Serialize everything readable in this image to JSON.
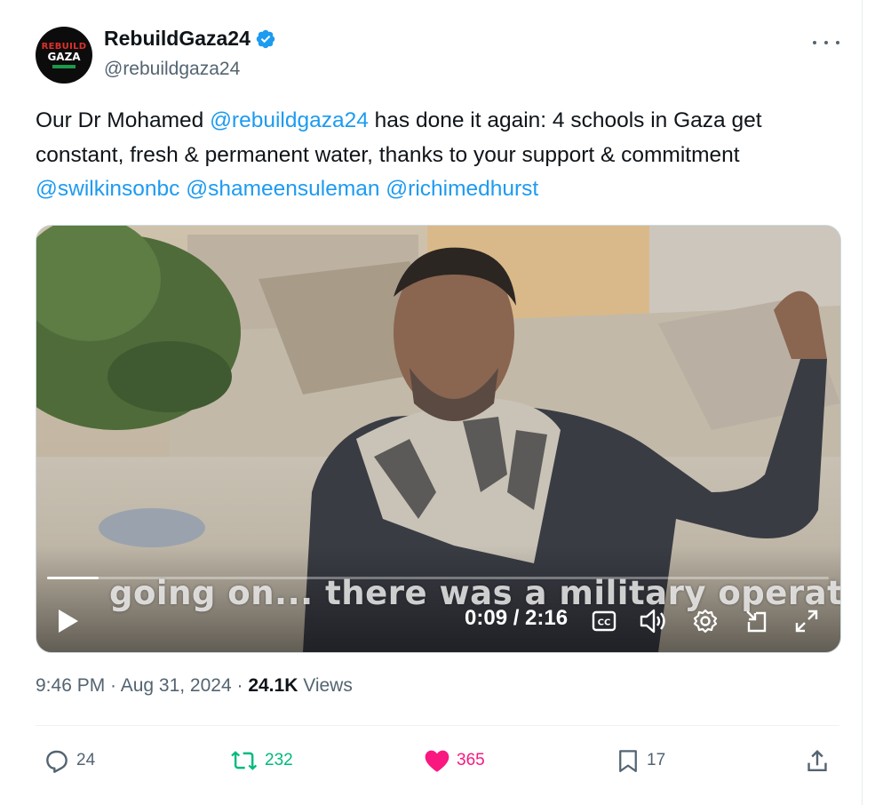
{
  "tweet": {
    "author": {
      "name": "RebuildGaza24",
      "handle": "@rebuildgaza24",
      "avatar_line1": "REBUILD",
      "avatar_line2": "GAZA",
      "verified_icon": "verified-badge-icon"
    },
    "text_segments": [
      {
        "text": "Our Dr Mohamed ",
        "type": "plain"
      },
      {
        "text": "@rebuildgaza24",
        "type": "mention"
      },
      {
        "text": " has done it again: 4 schools in Gaza get constant, fresh & permanent water, thanks to your support & commitment ",
        "type": "plain"
      },
      {
        "text": "@swilkinsonbc",
        "type": "mention"
      },
      {
        "text": " ",
        "type": "plain"
      },
      {
        "text": "@shameensuleman",
        "type": "mention"
      },
      {
        "text": " ",
        "type": "plain"
      },
      {
        "text": "@richimedhurst",
        "type": "mention"
      }
    ],
    "video": {
      "subtitle": "going on... there was a military operation",
      "time": "0:09 / 2:16",
      "progress": 0.066,
      "controls": [
        "play-icon",
        "captions-icon",
        "volume-icon",
        "settings-icon",
        "pip-icon",
        "fullscreen-icon"
      ]
    },
    "timestamp": "9:46 PM · Aug 31, 2024 · ",
    "views_count": "24.1K",
    "views_label": " Views",
    "actions": {
      "replies": "24",
      "reposts": "232",
      "likes": "365",
      "bookmarks": "17"
    },
    "colors": {
      "mention": "#1d9bf0",
      "repost": "#00ba7c",
      "like": "#f91880",
      "secondary": "#536471"
    }
  }
}
